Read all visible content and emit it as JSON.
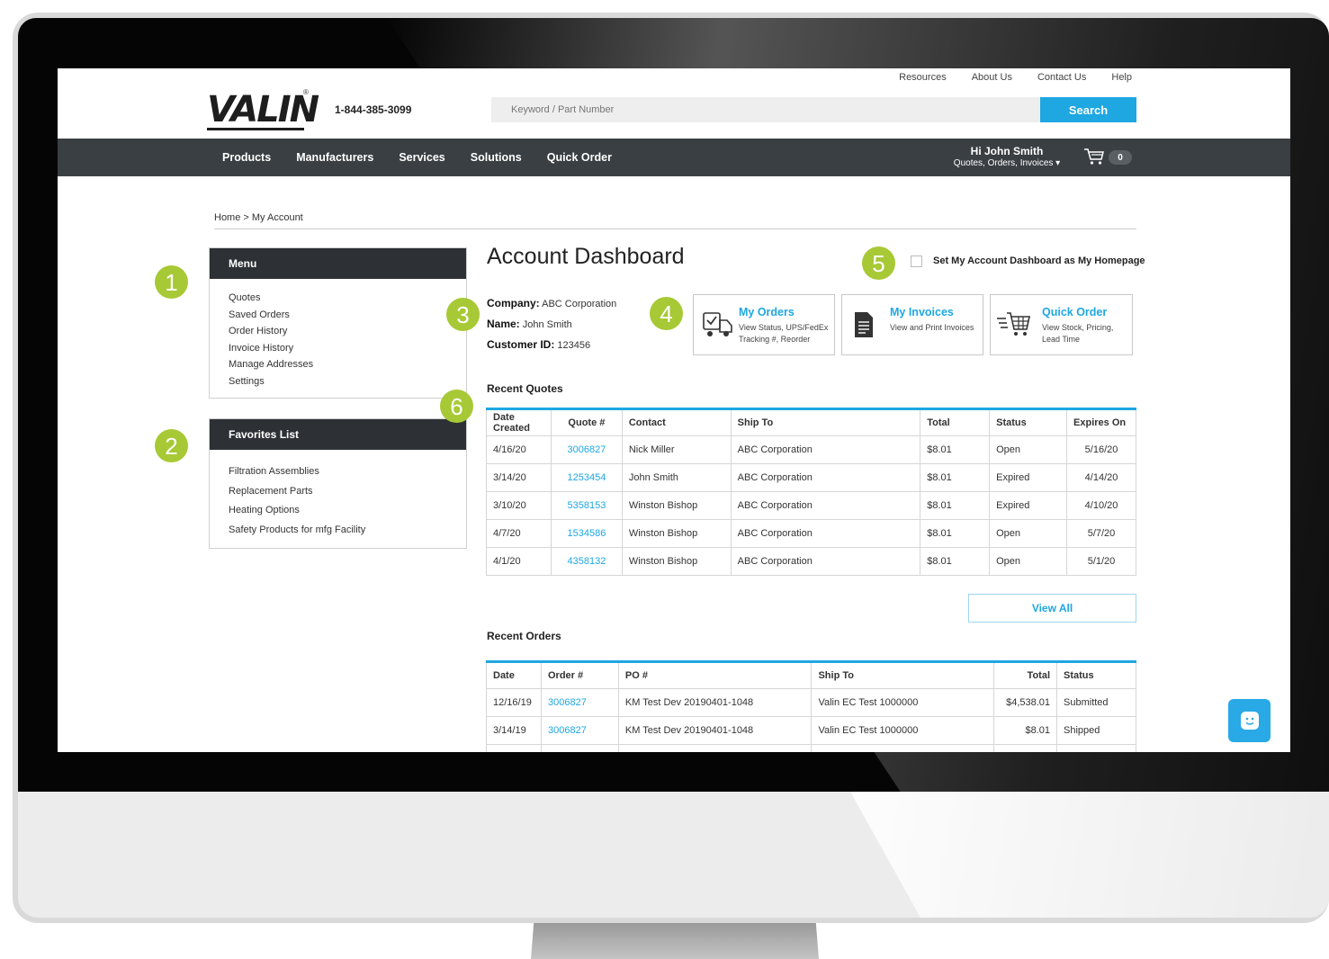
{
  "header": {
    "util_links": [
      "Resources",
      "About Us",
      "Contact Us",
      "Help"
    ],
    "logo": "VALIN",
    "logo_mark": "®",
    "phone": "1-844-385-3099",
    "search_placeholder": "Keyword / Part Number",
    "search_label": "Search"
  },
  "nav": {
    "items": [
      "Products",
      "Manufacturers",
      "Services",
      "Solutions",
      "Quick Order"
    ],
    "greeting": "Hi John Smith",
    "account_menu": "Quotes, Orders, Invoices ▾",
    "cart_count": "0"
  },
  "breadcrumb": "Home > My Account",
  "menu": {
    "title": "Menu",
    "items": [
      "Quotes",
      "Saved Orders",
      "Order History",
      "Invoice History",
      "Manage Addresses",
      "Settings"
    ]
  },
  "favorites": {
    "title": "Favorites List",
    "items": [
      "Filtration Assemblies",
      "Replacement Parts",
      "Heating Options",
      "Safety Products for mfg Facility"
    ]
  },
  "badges": [
    "1",
    "2",
    "3",
    "4",
    "5",
    "6"
  ],
  "dashboard": {
    "title": "Account Dashboard",
    "homepage_label": "Set My Account Dashboard as My Homepage",
    "company_label": "Company:",
    "company": "ABC Corporation",
    "name_label": "Name:",
    "name": "John Smith",
    "customer_id_label": "Customer ID:",
    "customer_id": "123456"
  },
  "cards": [
    {
      "title": "My Orders",
      "desc": [
        "View Status, UPS/FedEx",
        "Tracking #, Reorder"
      ]
    },
    {
      "title": "My Invoices",
      "desc": [
        "View and Print Invoices"
      ]
    },
    {
      "title": "Quick Order",
      "desc": [
        "View Stock, Pricing,",
        "Lead Time"
      ]
    }
  ],
  "recent_quotes": {
    "title": "Recent Quotes",
    "columns": [
      "Date Created",
      "Quote #",
      "Contact",
      "Ship To",
      "Total",
      "Status",
      "Expires On"
    ],
    "rows": [
      [
        "4/16/20",
        "3006827",
        "Nick Miller",
        "ABC Corporation",
        "$8.01",
        "Open",
        "5/16/20"
      ],
      [
        "3/14/20",
        "1253454",
        "John Smith",
        "ABC Corporation",
        "$8.01",
        "Expired",
        "4/14/20"
      ],
      [
        "3/10/20",
        "5358153",
        "Winston Bishop",
        "ABC Corporation",
        "$8.01",
        "Expired",
        "4/10/20"
      ],
      [
        "4/7/20",
        "1534586",
        "Winston Bishop",
        "ABC Corporation",
        "$8.01",
        "Open",
        "5/7/20"
      ],
      [
        "4/1/20",
        "4358132",
        "Winston Bishop",
        "ABC Corporation",
        "$8.01",
        "Open",
        "5/1/20"
      ]
    ],
    "view_all": "View All"
  },
  "recent_orders": {
    "title": "Recent Orders",
    "columns": [
      "Date",
      "Order #",
      "PO #",
      "Ship To",
      "Total",
      "Status"
    ],
    "rows": [
      [
        "12/16/19",
        "3006827",
        "KM Test Dev 20190401-1048",
        "Valin EC Test 1000000",
        "$4,538.01",
        "Submitted"
      ],
      [
        "3/14/19",
        "3006827",
        "KM Test Dev 20190401-1048",
        "Valin EC Test 1000000",
        "$8.01",
        "Shipped"
      ],
      [
        "",
        "",
        "",
        "",
        "",
        ""
      ]
    ]
  },
  "colors": {
    "accent": "#1ea7e1",
    "nav_bg": "#3a3f43",
    "badge": "#a7c935",
    "panel_head": "#2d3135"
  }
}
